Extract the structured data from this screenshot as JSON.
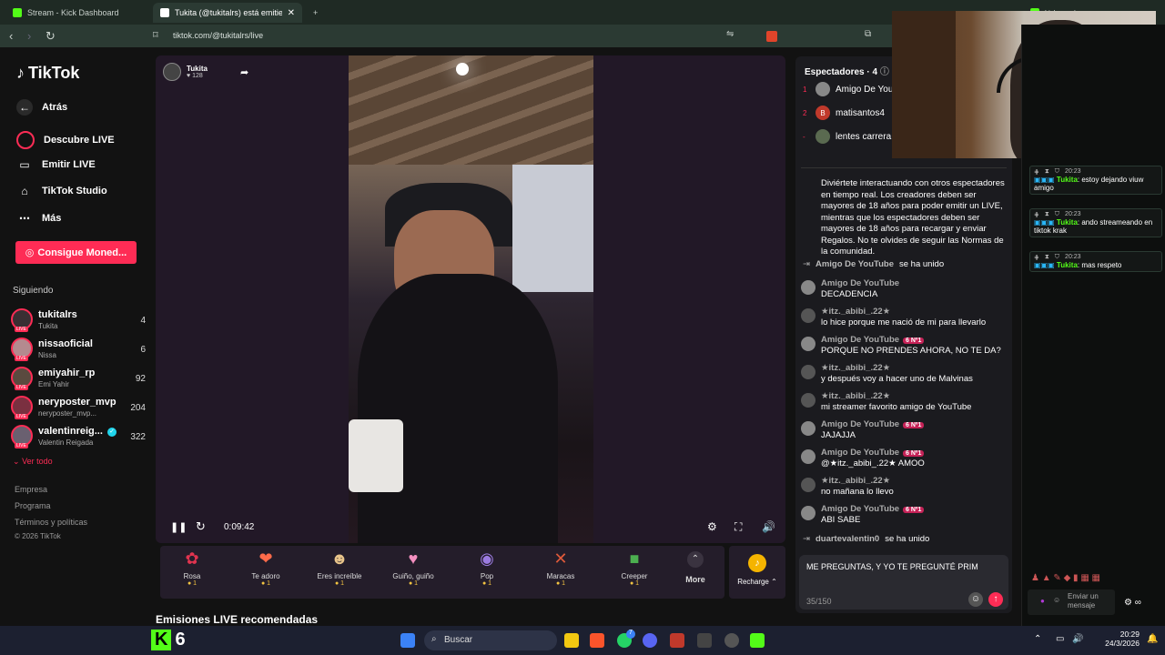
{
  "browser": {
    "tabs": [
      {
        "title": "Stream - Kick Dashboard"
      },
      {
        "title": "Tukita (@tukitalrs) está emitie"
      }
    ],
    "new_tab": "+",
    "url": "tiktok.com/@tukitalrs/live",
    "kick_tab_title": "kick.com/p..."
  },
  "sidebar": {
    "logo": "TikTok",
    "back_label": "Atrás",
    "nav": [
      {
        "label": "Descubre LIVE",
        "icon": "live-discover-icon"
      },
      {
        "label": "Emitir LIVE",
        "icon": "video-camera-icon"
      },
      {
        "label": "TikTok Studio",
        "icon": "home-icon"
      },
      {
        "label": "Más",
        "icon": "more-dots-icon"
      }
    ],
    "coins_button": "Consigue Moned...",
    "following_title": "Siguiendo",
    "following": [
      {
        "name": "tukitalrs",
        "sub": "Tukita",
        "count": "4"
      },
      {
        "name": "nissaoficial",
        "sub": "Nissa",
        "count": "6"
      },
      {
        "name": "emiyahir_rp",
        "sub": "Emi Yahir",
        "count": "92"
      },
      {
        "name": "neryposter_mvp",
        "sub": "neryposter_mvp...",
        "count": "204"
      },
      {
        "name": "valentinreig...",
        "sub": "Valentin Reigada",
        "count": "322"
      }
    ],
    "see_all": "Ver todo",
    "footer": [
      "Empresa",
      "Programa",
      "Términos y políticas",
      "© 2026 TikTok"
    ]
  },
  "stream": {
    "streamer": "Tukita",
    "likes": "128",
    "elapsed": "0:09:42"
  },
  "gifts": [
    {
      "name": "Rosa",
      "cost": "1",
      "icon": "rose-icon"
    },
    {
      "name": "Te adoro",
      "cost": "1",
      "icon": "heart-icon"
    },
    {
      "name": "Eres increíble",
      "cost": "1",
      "icon": "cat-icon"
    },
    {
      "name": "Guiño, guiño",
      "cost": "1",
      "icon": "wink-icon"
    },
    {
      "name": "Pop",
      "cost": "1",
      "icon": "pop-icon"
    },
    {
      "name": "Maracas",
      "cost": "1",
      "icon": "maracas-icon"
    },
    {
      "name": "Creeper",
      "cost": "1",
      "icon": "creeper-icon"
    }
  ],
  "more_label": "More",
  "recharge_label": "Recharge",
  "recommended_title": "Emisiones LIVE recomendadas",
  "chat": {
    "viewers_title": "Espectadores",
    "viewers_count": "4",
    "viewers": [
      {
        "rank": "1",
        "name": "Amigo De YouT",
        "initial": ""
      },
      {
        "rank": "2",
        "name": "matisantos4",
        "initial": "B"
      },
      {
        "rank": "-",
        "name": "lentes carrera",
        "initial": ""
      }
    ],
    "info": "Diviértete interactuando con otros espectadores en tiempo real. Los creadores deben ser mayores de 18 años para poder emitir un LIVE, mientras que los espectadores deben ser mayores de 18 años para recargar y enviar Regalos. No te olvides de seguir las Normas de la comunidad.",
    "messages": [
      {
        "type": "joined",
        "user": "Amigo De YouTube",
        "text": "se ha unido"
      },
      {
        "type": "msg",
        "user": "Amigo De YouTube",
        "badge": "",
        "text": "DECADENCIA"
      },
      {
        "type": "msg",
        "user": "★itz._abibi_.22★",
        "badge": "",
        "text": "lo hice porque me nació de mi para llevarlo"
      },
      {
        "type": "msg",
        "user": "Amigo De YouTube",
        "badge": "6 Nº1",
        "text": "PORQUE NO PRENDES AHORA, NO TE DA?"
      },
      {
        "type": "msg",
        "user": "★itz._abibi_.22★",
        "badge": "",
        "text": "y después voy a hacer uno de Malvinas"
      },
      {
        "type": "msg",
        "user": "★itz._abibi_.22★",
        "badge": "",
        "text": "mi streamer favorito amigo de YouTube"
      },
      {
        "type": "msg",
        "user": "Amigo De YouTube",
        "badge": "6 Nº1",
        "text": "JAJAJJA"
      },
      {
        "type": "msg",
        "user": "Amigo De YouTube",
        "badge": "6 Nº1",
        "text": "@★itz._abibi_.22★ AMOO"
      },
      {
        "type": "msg",
        "user": "★itz._abibi_.22★",
        "badge": "",
        "text": "no mañana lo llevo"
      },
      {
        "type": "msg",
        "user": "Amigo De YouTube",
        "badge": "6 Nº1",
        "text": "ABI SABE"
      },
      {
        "type": "joined",
        "user": "duartevalentin0",
        "text": "se ha unido"
      }
    ],
    "input_value": "ME PREGUNTAS, Y YO TE PREGUNTÉ PRIM",
    "char_count": "35/150"
  },
  "kick": {
    "messages": [
      {
        "time": "20:23",
        "user": "Tukita",
        "text": "estoy dejando viuw amigo"
      },
      {
        "time": "20:23",
        "user": "Tukita",
        "text": "ando streameando en tiktok krak"
      },
      {
        "time": "20:23",
        "user": "Tukita",
        "text": "mas respeto"
      }
    ],
    "send_label": "Enviar un mensaje"
  },
  "taskbar": {
    "kick_count": "6",
    "search_placeholder": "Buscar",
    "time": "20:29",
    "date": "24/3/2026",
    "whatsapp_badge": "7"
  },
  "colors": {
    "tiktok_red": "#fe2c55",
    "kick_green": "#53fc18"
  }
}
